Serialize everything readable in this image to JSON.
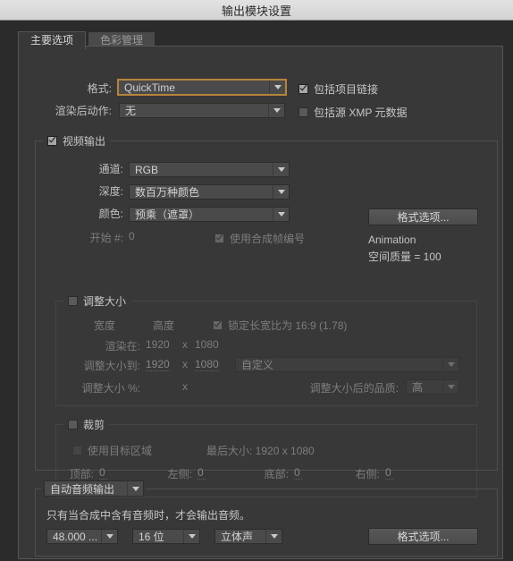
{
  "window": {
    "title": "输出模块设置"
  },
  "tabs": [
    {
      "label": "主要选项",
      "active": true
    },
    {
      "label": "色彩管理",
      "active": false
    }
  ],
  "format_section": {
    "format_label": "格式:",
    "format_value": "QuickTime",
    "post_render_label": "渲染后动作:",
    "post_render_value": "无",
    "include_project_link_label": "包括项目链接",
    "include_project_link_checked": true,
    "include_xmp_label": "包括源 XMP 元数据",
    "include_xmp_checked": false
  },
  "video_output": {
    "legend": "视频输出",
    "legend_checked": true,
    "channels_label": "通道:",
    "channels_value": "RGB",
    "depth_label": "深度:",
    "depth_value": "数百万种颜色",
    "color_label": "颜色:",
    "color_value": "预乘（遮罩）",
    "start_label": "开始 #:",
    "start_value": "0",
    "use_comp_frame_label": "使用合成帧编号",
    "use_comp_frame_checked": true,
    "format_options_button": "格式选项...",
    "codec_name": "Animation",
    "spatial_quality": "空间质量 = 100"
  },
  "resize": {
    "legend": "调整大小",
    "legend_checked": false,
    "width_header": "宽度",
    "height_header": "高度",
    "lock_aspect_label": "锁定长宽比为 16:9 (1.78)",
    "lock_aspect_checked": true,
    "render_at_label": "渲染在:",
    "render_at_width": "1920",
    "render_at_x": "x",
    "render_at_height": "1080",
    "resize_to_label": "调整大小到:",
    "resize_to_width": "1920",
    "resize_to_x": "x",
    "resize_to_height": "1080",
    "preset_value": "自定义",
    "resize_pct_label": "调整大小 %:",
    "resize_pct_width": "",
    "resize_pct_x": "x",
    "resize_pct_height": "",
    "quality_label": "调整大小后的品质:",
    "quality_value": "高"
  },
  "crop": {
    "legend": "裁剪",
    "legend_checked": false,
    "use_target_region_label": "使用目标区域",
    "use_target_region_checked": false,
    "final_size_label": "最后大小: 1920 x 1080",
    "top_label": "顶部:",
    "top_value": "0",
    "left_label": "左侧:",
    "left_value": "0",
    "bottom_label": "底部:",
    "bottom_value": "0",
    "right_label": "右侧:",
    "right_value": "0"
  },
  "audio_output": {
    "legend_value": "自动音频输出",
    "note": "只有当合成中含有音频时，才会输出音频。",
    "sample_rate": "48.000 ...",
    "bit_depth": "16 位",
    "channels": "立体声",
    "format_options_button": "格式选项..."
  },
  "icons": {
    "chevron_down": "chevron-down-icon",
    "check": "check-icon"
  },
  "colors": {
    "focus_border": "#b5843c",
    "panel_bg": "#383838",
    "window_bg": "#2b2b2b",
    "titlebar_bg": "#d9d9d9"
  }
}
